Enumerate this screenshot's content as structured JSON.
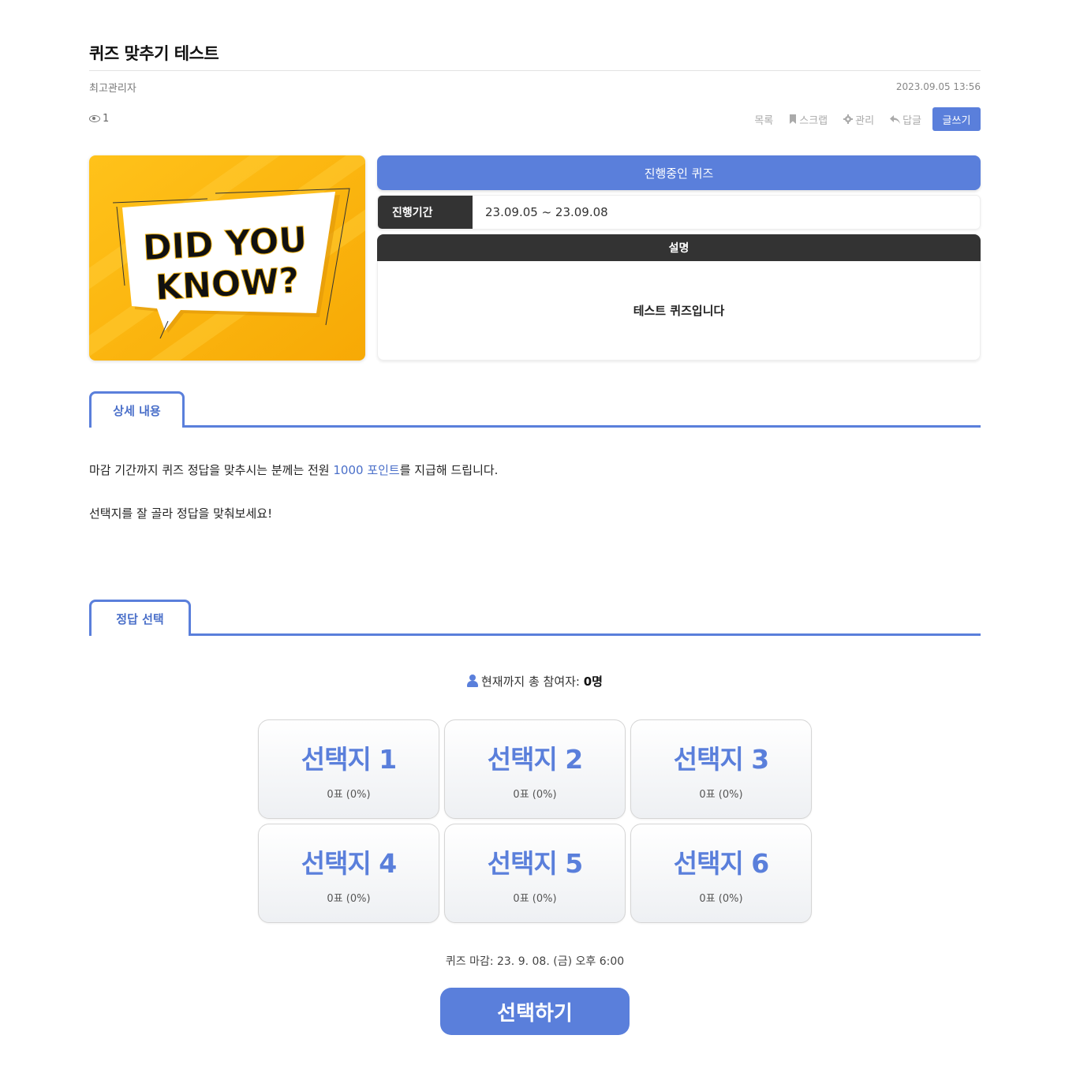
{
  "post": {
    "title": "퀴즈 맞추기 테스트",
    "author": "최고관리자",
    "date": "2023.09.05 13:56",
    "views": "1"
  },
  "actions": {
    "list": "목록",
    "scrap": "스크랩",
    "manage": "관리",
    "reply": "답글",
    "write": "글쓰기"
  },
  "banner": {
    "line1": "DID YOU",
    "line2": "KNOW?"
  },
  "quiz": {
    "status": "진행중인 퀴즈",
    "period_label": "진행기간",
    "period_value": "23.09.05 ~ 23.09.08",
    "desc_label": "설명",
    "desc_value": "테스트 퀴즈입니다"
  },
  "tabs": {
    "detail": "상세 내용",
    "answer": "정답 선택"
  },
  "content": {
    "p1_before": "마감 기간까지 퀴즈 정답을 맞추시는 분께는 전원 ",
    "p1_highlight": "1000 포인트",
    "p1_after": "를 지급해 드립니다.",
    "p2": "선택지를 잘 골라 정답을 맞춰보세요!"
  },
  "participants": {
    "label": "현재까지 총 참여자: ",
    "count": "0명"
  },
  "choices": [
    {
      "name": "선택지 1",
      "votes": "0표 (0%)"
    },
    {
      "name": "선택지 2",
      "votes": "0표 (0%)"
    },
    {
      "name": "선택지 3",
      "votes": "0표 (0%)"
    },
    {
      "name": "선택지 4",
      "votes": "0표 (0%)"
    },
    {
      "name": "선택지 5",
      "votes": "0표 (0%)"
    },
    {
      "name": "선택지 6",
      "votes": "0표 (0%)"
    }
  ],
  "deadline": "퀴즈 마감: 23. 9. 08. (금) 오후 6:00",
  "submit_label": "선택하기",
  "colors": {
    "accent": "#5a7fdb",
    "dark": "#333333",
    "banner_yellow": "#fbb80f"
  }
}
